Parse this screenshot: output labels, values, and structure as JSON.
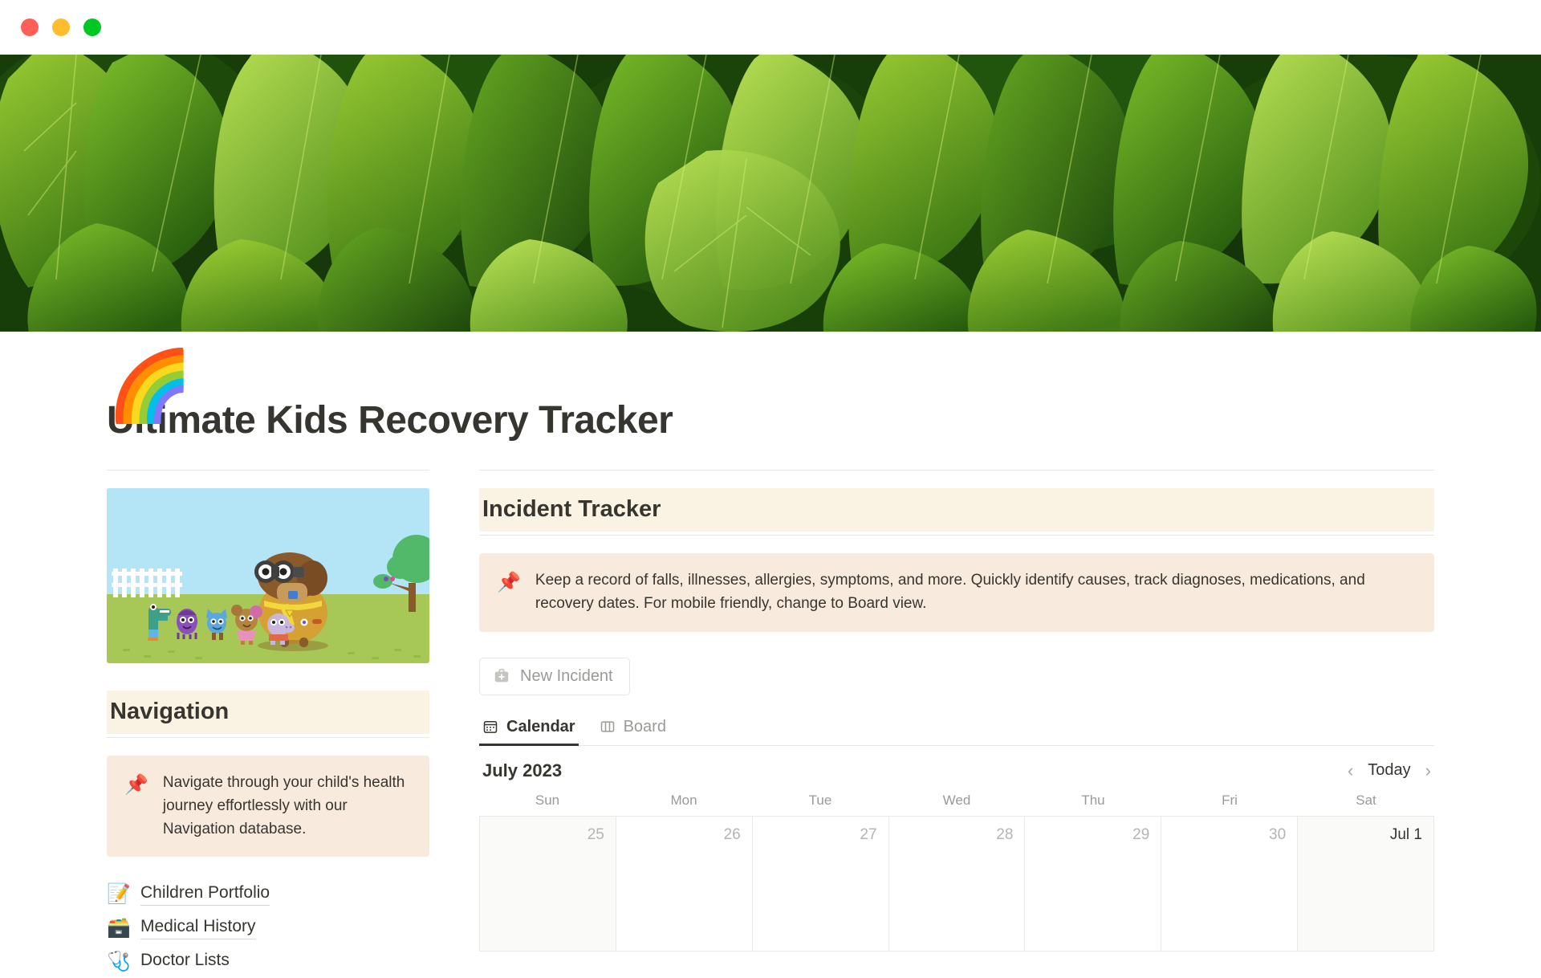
{
  "window": {
    "controls": [
      "close",
      "minimize",
      "maximize"
    ],
    "colors": {
      "close": "#ff5f57",
      "minimize": "#febc2e",
      "maximize": "#00c822"
    }
  },
  "cover": {
    "name": "green-ivy-leaves-cover"
  },
  "page": {
    "icon": "🌈",
    "title": "Ultimate Kids Recovery Tracker"
  },
  "sidebar": {
    "illustration_alt": "cartoon dog with binoculars and squirrel club characters in a park",
    "heading": "Navigation",
    "callout": {
      "icon": "📌",
      "text": "Navigate through your child's health journey effortlessly with our Navigation database."
    },
    "items": [
      {
        "icon": "📝",
        "label": "Children Portfolio"
      },
      {
        "icon": "🗃️",
        "label": "Medical History"
      },
      {
        "icon": "🩺",
        "label": "Doctor Lists"
      }
    ]
  },
  "main": {
    "heading": "Incident Tracker",
    "callout": {
      "icon": "📌",
      "text": "Keep a record of falls, illnesses, allergies, symptoms, and more. Quickly identify causes, track diagnoses, medications, and recovery dates. For mobile friendly, change to Board view."
    },
    "new_button": {
      "icon": "medical-bag-icon",
      "label": "New Incident"
    },
    "tabs": [
      {
        "icon": "calendar-icon",
        "label": "Calendar",
        "active": true
      },
      {
        "icon": "board-icon",
        "label": "Board",
        "active": false
      }
    ],
    "calendar": {
      "month_label": "July 2023",
      "today_label": "Today",
      "prev_label": "‹",
      "next_label": "›",
      "day_headers": [
        "Sun",
        "Mon",
        "Tue",
        "Wed",
        "Thu",
        "Fri",
        "Sat"
      ],
      "cells": [
        {
          "label": "25",
          "out_of_month": true,
          "weekend": true
        },
        {
          "label": "26",
          "out_of_month": true,
          "weekend": false
        },
        {
          "label": "27",
          "out_of_month": true,
          "weekend": false
        },
        {
          "label": "28",
          "out_of_month": true,
          "weekend": false
        },
        {
          "label": "29",
          "out_of_month": true,
          "weekend": false
        },
        {
          "label": "30",
          "out_of_month": true,
          "weekend": false
        },
        {
          "label": "Jul 1",
          "out_of_month": false,
          "weekend": true
        }
      ]
    }
  },
  "theme": {
    "heading_bg": "#faf3e3",
    "callout_bg": "#f8ebdd",
    "text": "#37352f",
    "muted": "#9b9a97",
    "border": "#e6e6e4"
  }
}
